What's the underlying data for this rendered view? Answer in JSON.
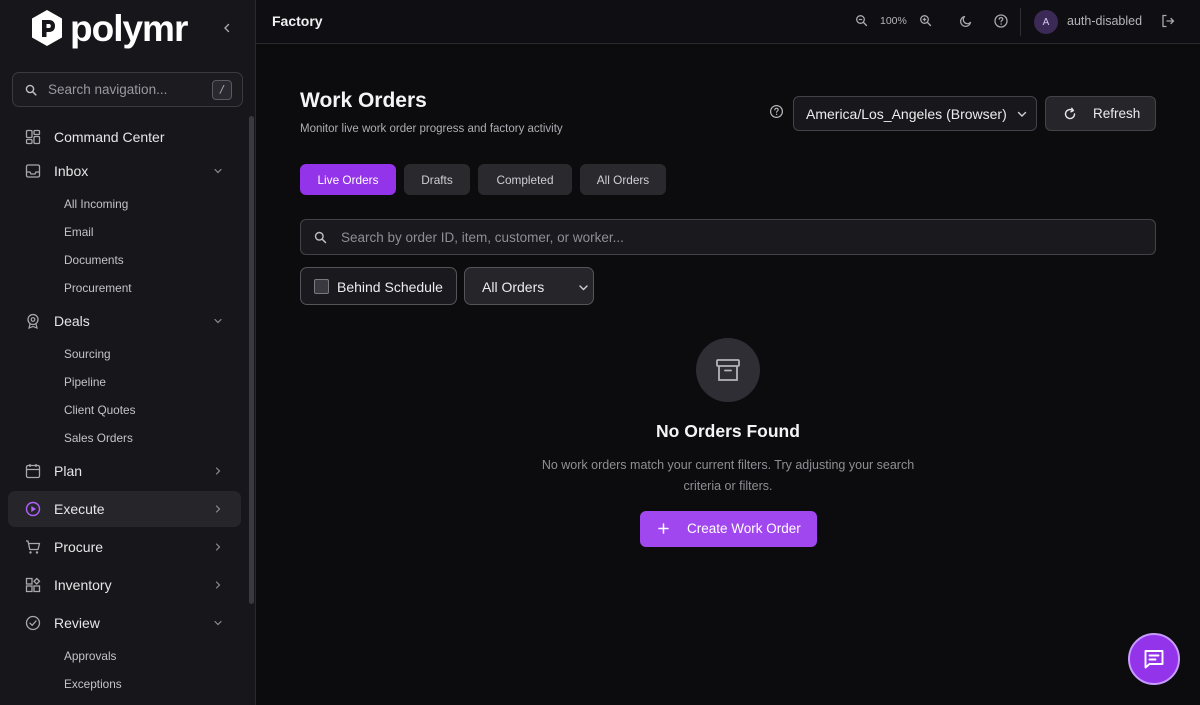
{
  "brand": {
    "name": "polymr"
  },
  "sidebar": {
    "search_placeholder": "Search navigation...",
    "search_shortcut": "/",
    "items": [
      {
        "label": "Command Center",
        "icon": "dashboard-icon"
      },
      {
        "label": "Inbox",
        "icon": "inbox-icon",
        "expanded": true,
        "children": [
          "All Incoming",
          "Email",
          "Documents",
          "Procurement"
        ]
      },
      {
        "label": "Deals",
        "icon": "deals-icon",
        "expanded": true,
        "children": [
          "Sourcing",
          "Pipeline",
          "Client Quotes",
          "Sales Orders"
        ]
      },
      {
        "label": "Plan",
        "icon": "calendar-icon",
        "expanded": false
      },
      {
        "label": "Execute",
        "icon": "play-circle-icon",
        "expanded": false,
        "active": true
      },
      {
        "label": "Procure",
        "icon": "cart-icon",
        "expanded": false
      },
      {
        "label": "Inventory",
        "icon": "boxes-icon",
        "expanded": false
      },
      {
        "label": "Review",
        "icon": "check-circle-icon",
        "expanded": true,
        "children": [
          "Approvals",
          "Exceptions"
        ]
      }
    ]
  },
  "topbar": {
    "breadcrumb": "Factory",
    "zoom_level": "100%",
    "avatar_initial": "A",
    "user_name": "auth-disabled"
  },
  "main": {
    "title": "Work Orders",
    "subtitle": "Monitor live work order progress and factory activity",
    "timezone": "America/Los_Angeles (Browser)",
    "refresh_label": "Refresh",
    "tabs": [
      {
        "label": "Live Orders",
        "active": true
      },
      {
        "label": "Drafts",
        "active": false
      },
      {
        "label": "Completed",
        "active": false
      },
      {
        "label": "All Orders",
        "active": false
      }
    ],
    "search_placeholder": "Search by order ID, item, customer, or worker...",
    "search_value": "",
    "behind_schedule_label": "Behind Schedule",
    "behind_schedule_checked": false,
    "order_filter": "All Orders",
    "empty": {
      "title": "No Orders Found",
      "description": "No work orders match your current filters. Try adjusting your search criteria or filters.",
      "create_label": "Create Work Order"
    }
  },
  "colors": {
    "accent": "#9333ea",
    "accent_light": "#a147f0",
    "background": "#0c0b0e",
    "sidebar": "#17161a"
  }
}
